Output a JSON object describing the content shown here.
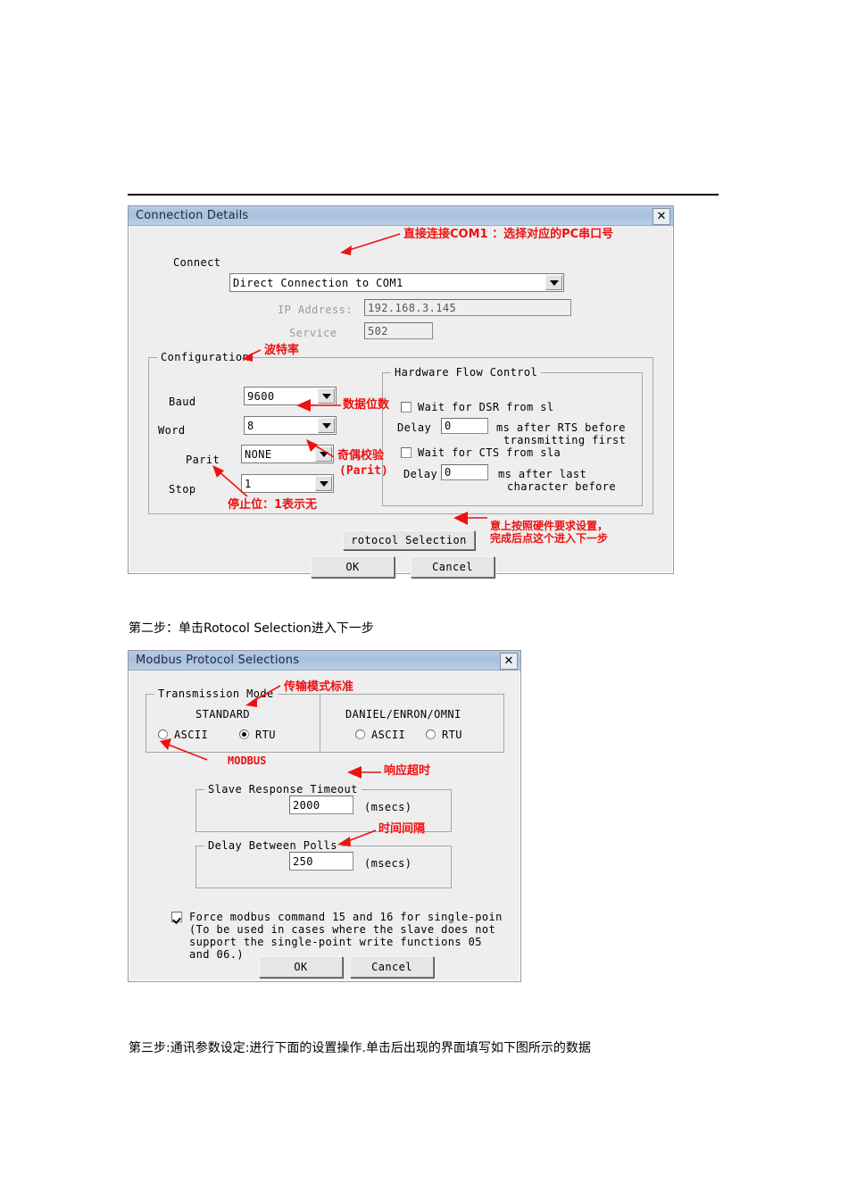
{
  "page": {
    "caption_step2": "第二步：单击Rotocol Selection进入下一步",
    "caption_step3": "第三步:通讯参数设定:进行下面的设置操作.单击后出现的界面填写如下图所示的数据"
  },
  "colors": {
    "annotation_red": "#ee1111",
    "title_bar": "#afc6e1",
    "dialog_face": "#eeeeee"
  },
  "dialog1": {
    "title": "Connection Details",
    "close_label": "✕",
    "connect_label": "Connect",
    "connection_value": "Direct Connection to COM1",
    "ip_label": "IP Address:",
    "ip_value": "192.168.3.145",
    "service_label": "Service",
    "service_value": "502",
    "configuration_group": "Configuration",
    "baud_label": "Baud",
    "baud_value": "9600",
    "word_label": "Word",
    "word_value": "8",
    "parity_label": "Parit",
    "parity_value": "NONE",
    "stop_label": "Stop",
    "stop_value": "1",
    "hfc_group": "Hardware Flow Control",
    "wait_dsr_label": "Wait for DSR from sl",
    "wait_dsr_checked": false,
    "delay1_label": "Delay",
    "delay1_value": "0",
    "delay1_suffix_line1": "ms after RTS before",
    "delay1_suffix_line2": "transmitting first",
    "wait_cts_label": "Wait for CTS from sla",
    "wait_cts_checked": false,
    "delay2_label": "Delay",
    "delay2_value": "0",
    "delay2_suffix_line1": "ms after last",
    "delay2_suffix_line2": "character before",
    "protocol_btn": "rotocol Selection",
    "ok_btn": "OK",
    "cancel_btn": "Cancel",
    "annotations": {
      "connect": "直接连接COM1 ：选择对应的PC串口号",
      "baud": "波特率",
      "word": "数据位数",
      "parity_line1": "奇偶校验",
      "parity_line2": "(Parit)",
      "stop": "停止位：1表示无",
      "protocol_line1": "意上按照硬件要求设置，",
      "protocol_line2": "完成后点这个进入下一步"
    }
  },
  "dialog2": {
    "title": "Modbus Protocol Selections",
    "close_label": "✕",
    "transmission_group": "Transmission Mode",
    "standard_header": "STANDARD",
    "daniel_header": "DANIEL/ENRON/OMNI",
    "std_ascii_label": "ASCII",
    "std_ascii_checked": false,
    "std_rtu_label": "RTU",
    "std_rtu_checked": true,
    "dan_ascii_label": "ASCII",
    "dan_ascii_checked": false,
    "dan_rtu_label": "RTU",
    "dan_rtu_checked": false,
    "timeout_group": "Slave Response Timeout",
    "timeout_value": "2000",
    "timeout_units": "(msecs)",
    "polls_group": "Delay Between Polls",
    "polls_value": "250",
    "polls_units": "(msecs)",
    "force_checked": true,
    "force_line1": "Force modbus command 15 and 16 for single-poin",
    "force_line2": "(To be used in cases where the slave does not",
    "force_line3": "support the single-point write functions 05",
    "force_line4": "and 06.)",
    "ok_btn": "OK",
    "cancel_btn": "Cancel",
    "annotations": {
      "transmission": "传输模式标准",
      "modbus": "MODBUS",
      "timeout": "响应超时",
      "polls": "时间间隔"
    }
  }
}
